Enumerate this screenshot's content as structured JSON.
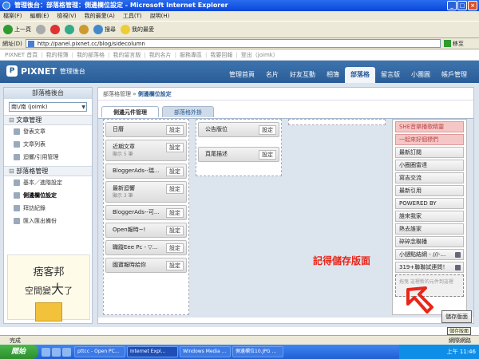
{
  "window": {
    "title": "管理後台：部落格管理：側邊欄位設定 - Microsoft Internet Explorer"
  },
  "menu": [
    "檔案(F)",
    "編輯(E)",
    "檢視(V)",
    "我的最愛(A)",
    "工具(T)",
    "說明(H)"
  ],
  "toolbar": {
    "back": "上一頁",
    "search": "搜尋",
    "favorites": "我的最愛"
  },
  "address": {
    "label": "網址(D)",
    "url": "http://panel.pixnet.cc/blog/sidecolumn",
    "go": "移至"
  },
  "pixnet_top": [
    "PIXNET 首頁",
    "我的相簿",
    "我的部落格",
    "我的留言版",
    "我的名片",
    "服務專區",
    "我要回報",
    "登出（joimk）"
  ],
  "header": {
    "logo": "PIXNET",
    "logo_sub": "管理後台",
    "nav": [
      "管理首頁",
      "名片",
      "好友互動",
      "相簿",
      "部落格",
      "留言版",
      "小團圓",
      "帳戶管理"
    ],
    "active": "部落格"
  },
  "sidebar": {
    "title": "部落格後台",
    "select": "南\\/南 (joimk)",
    "sec1": "文章管理",
    "items1": [
      "發表文章",
      "文章列表",
      "迴響/引用管理"
    ],
    "sec2": "部落格管理",
    "items2": [
      "基本／進階設定",
      "側邊欄位設定",
      "拜訪紀錄",
      "匯入匯出備份"
    ],
    "ad_l1": "痞客邦",
    "ad_l2a": "空間變",
    "ad_l2b": "大",
    "ad_l2c": "了"
  },
  "crumb": {
    "root": "部落格管理",
    "sep": "»",
    "cur": "側邊欄位設定"
  },
  "subtabs": [
    "側邊元件管理",
    "部落格外掛"
  ],
  "col1": [
    {
      "t": "日曆"
    },
    {
      "t": "近期文章",
      "s": "顯示 5 筆"
    },
    {
      "t": "BloggerAds--瑞..."
    },
    {
      "t": "最新迴響",
      "s": "顯示 3 筆"
    },
    {
      "t": "BloggerAds--可..."
    },
    {
      "t": "Open報時~!"
    },
    {
      "t": "職蹤Eee Pc - ▽..."
    },
    {
      "t": "國寶報時給你"
    }
  ],
  "col2": [
    {
      "t": "公告版位"
    },
    {
      "t": "頁尾描述"
    }
  ],
  "setting": "設定",
  "rcol": [
    "SHE音樂播歌精靈",
    "一起來好個標們",
    "最新訂閱",
    "小圈圈雷達",
    "寫吉交流",
    "最新引用",
    "POWERED BY",
    "誰來我家",
    "熱去誰家",
    "碎碎念聯播",
    "小鏈點結網 - ///-...",
    "319+聯聯試連問！",
    "拖曳 這裡新的元件到這裡"
  ],
  "annotation": "記得儲存版面",
  "save": "儲存版面",
  "tooltip": "儲存版面",
  "status": {
    "left": "完成",
    "right": "網際網路"
  },
  "taskbar": {
    "start": "開始",
    "tasks": [
      "pttcc - Open PC...",
      "Internet Expl...",
      "Windows Media ...",
      "側邊欄位10.JPG ..."
    ],
    "clock": "上午 11:46"
  }
}
